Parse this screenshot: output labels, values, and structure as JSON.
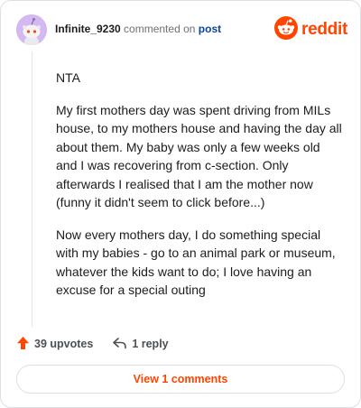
{
  "header": {
    "username": "Infinite_9230",
    "action_text": "commented on",
    "post_link": "post",
    "brand_word": "reddit",
    "avatar_icon": "snoo-avatar-icon",
    "brand_icon": "reddit-alien-icon"
  },
  "comment": {
    "paragraphs": [
      "NTA",
      "My first mothers day was spent driving from MILs house, to my mothers house and having the day all about them. My baby was only a few weeks old and I was recovering from c-section. Only afterwards I realised that I am the mother now (funny it didn't seem to click before...)",
      "Now every mothers day, I do something special with my babies - go to an animal park or museum, whatever the kids want to do; I love having an excuse for a special outing"
    ]
  },
  "actions": {
    "upvotes_label": "39 upvotes",
    "reply_label": "1 reply",
    "upvote_icon": "upvote-arrow-icon",
    "reply_icon": "reply-arrow-icon"
  },
  "footer": {
    "view_comments_label": "View 1 comments"
  },
  "colors": {
    "brand": "#ff4500",
    "link": "#0a449b",
    "avatar_bg": "#d4b8f2",
    "border": "#dcdfe3"
  }
}
